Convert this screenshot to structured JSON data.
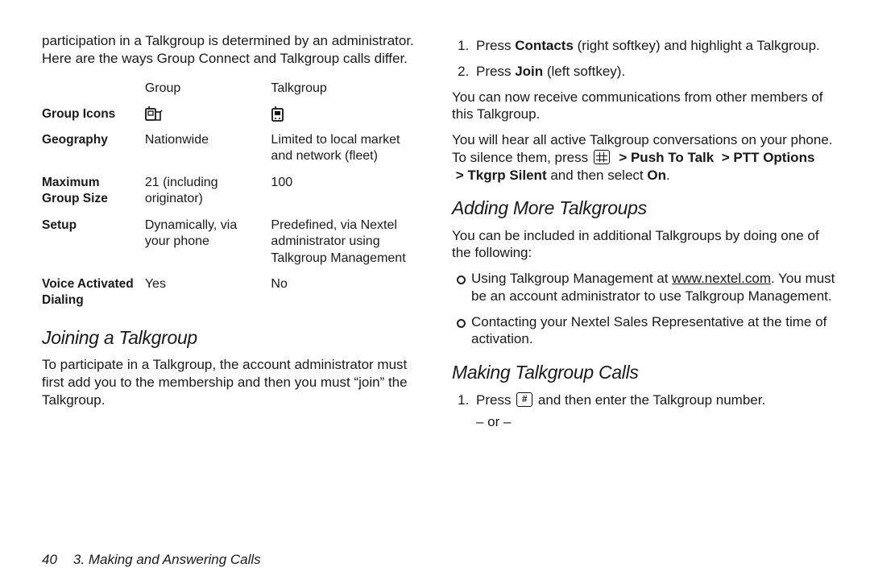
{
  "left": {
    "intro": "participation in a Talkgroup is determined by an administrator. Here are the ways Group Connect and Talkgroup calls differ.",
    "table": {
      "headers": {
        "col2": "Group",
        "col3": "Talkgroup"
      },
      "rows": {
        "icons_label": "Group Icons",
        "geography": {
          "label": "Geography",
          "group": "Nationwide",
          "talk": "Limited to local market and network (fleet)"
        },
        "max": {
          "label": "Maximum Group Size",
          "group": "21 (including originator)",
          "talk": "100"
        },
        "setup": {
          "label": "Setup",
          "group": "Dynamically, via your phone",
          "talk": "Predefined, via Nextel administrator using Talkgroup Management"
        },
        "voice": {
          "label": "Voice Activated Dialing",
          "group": "Yes",
          "talk": "No"
        }
      }
    },
    "joining": {
      "heading": "Joining a Talkgroup",
      "body": "To participate in a Talkgroup, the account administrator must first add you to the membership and then you must “join” the Talkgroup."
    }
  },
  "right": {
    "steps_top": {
      "s1_pre": "Press ",
      "s1_bold": "Contacts",
      "s1_post": " (right softkey) and highlight a Talkgroup.",
      "s2_pre": "Press ",
      "s2_bold": "Join",
      "s2_post": " (left softkey)."
    },
    "p_receive": "You can now receive communications from other members of this Talkgroup.",
    "p_silence_pre": "You will hear all active Talkgroup conversations on your phone. To silence them, press ",
    "p_silence_seq": {
      "a": "Push To Talk",
      "b": "PTT Options",
      "c": "Tkgrp Silent",
      "tail_pre": " and then select ",
      "on": "On",
      "tail_post": "."
    },
    "adding": {
      "heading": "Adding More Talkgroups",
      "intro": "You can be included in additional Talkgroups by doing one of the following:",
      "b1_pre": "Using Talkgroup Management at ",
      "b1_link": "www.nextel.com",
      "b1_post": ". You must be an account administrator to use Talkgroup Management.",
      "b2": "Contacting your Nextel Sales Representative at the time of activation."
    },
    "making": {
      "heading": "Making Talkgroup Calls",
      "s1_pre": "Press ",
      "s1_post": " and then enter the Talkgroup number.",
      "or": "– or –"
    }
  },
  "footer": {
    "page": "40",
    "chapter": "3. Making and Answering Calls"
  },
  "icons": {
    "group": "group-connect-icon",
    "talkgroup": "talkgroup-icon",
    "menu_key": "menu-key-icon",
    "hash_key": "hash-key-icon"
  }
}
